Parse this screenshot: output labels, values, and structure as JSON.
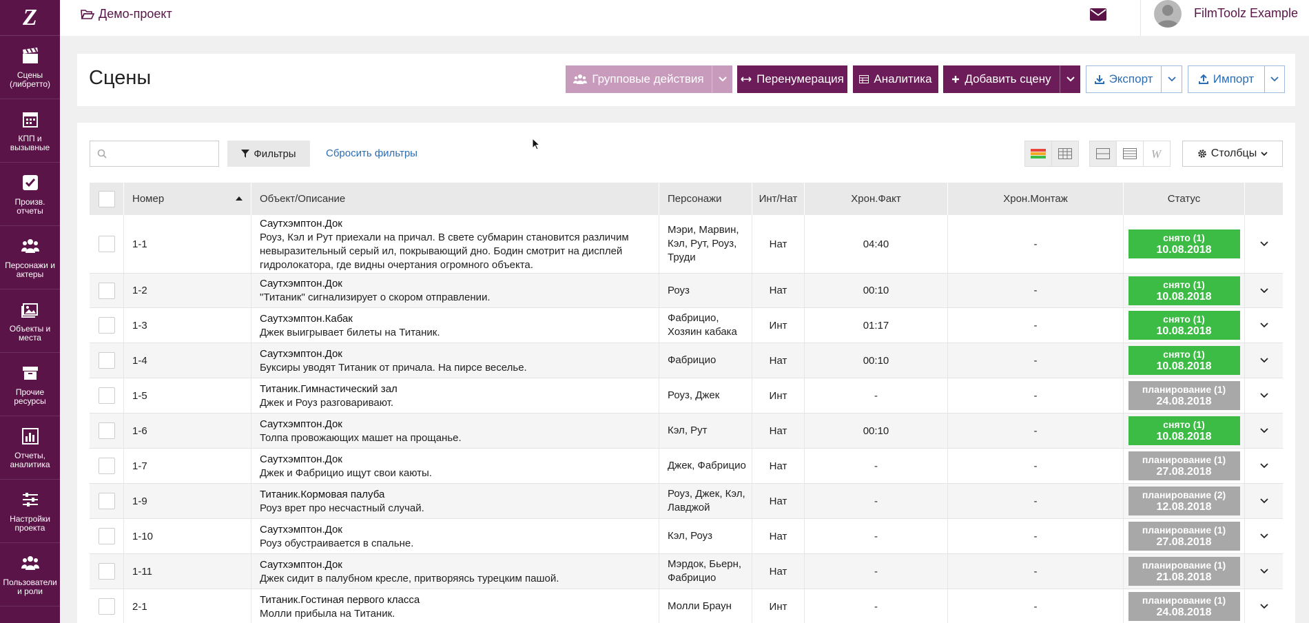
{
  "sidebar": {
    "logo": "Z",
    "items": [
      {
        "label": "Сцены (либретто)",
        "icon": "clapperboard-icon"
      },
      {
        "label": "КПП и вызывные",
        "icon": "calendar-icon"
      },
      {
        "label": "Произв. отчеты",
        "icon": "checkbox-icon"
      },
      {
        "label": "Персонажи и актеры",
        "icon": "users-icon"
      },
      {
        "label": "Объекты и места",
        "icon": "image-icon"
      },
      {
        "label": "Прочие ресурсы",
        "icon": "archive-icon"
      },
      {
        "label": "Отчеты, аналитика",
        "icon": "bar-chart-icon"
      },
      {
        "label": "Настройки проекта",
        "icon": "sliders-icon"
      },
      {
        "label": "Пользователи и роли",
        "icon": "users-icon"
      }
    ]
  },
  "topbar": {
    "project": "Демо-проект",
    "username": "FilmToolz Example"
  },
  "header": {
    "title": "Сцены",
    "bulk_actions": "Групповые действия",
    "renumber": "Перенумерация",
    "analytics": "Аналитика",
    "add_scene": "Добавить сцену",
    "export": "Экспорт",
    "import": "Импорт"
  },
  "toolbar": {
    "search_placeholder": "",
    "filters": "Фильтры",
    "reset_filters": "Сбросить фильтры",
    "columns": "Столбцы"
  },
  "table": {
    "headers": {
      "number": "Номер",
      "object": "Объект/Описание",
      "characters": "Персонажи",
      "int_nat": "Инт/Нат",
      "chron_fact": "Хрон.Факт",
      "chron_edit": "Хрон.Монтаж",
      "status": "Статус"
    },
    "rows": [
      {
        "num": "1-1",
        "object": "Саутхэмптон.Док",
        "desc": "Роуз, Кэл и Рут приехали на причал. В свете субмарин становится различим невыразительный серый ил, покрывающий дно. Бодин смотрит на дисплей гидролокатора, где видны очертания огромного объекта.",
        "chars": "Мэри, Марвин, Кэл, Рут, Роуз, Труди",
        "intnat": "Нат",
        "fact": "04:40",
        "edit": "-",
        "status": "снято (1)",
        "date": "10.08.2018",
        "color": "#3cbc45"
      },
      {
        "num": "1-2",
        "object": "Саутхэмптон.Док",
        "desc": "\"Титаник\" сигнализирует о скором отправлении.",
        "chars": "Роуз",
        "intnat": "Нат",
        "fact": "00:10",
        "edit": "-",
        "status": "снято (1)",
        "date": "10.08.2018",
        "color": "#3cbc45"
      },
      {
        "num": "1-3",
        "object": "Саутхэмптон.Кабак",
        "desc": "Джек выигрывает билеты на Титаник.",
        "chars": "Фабрицио, Хозяин кабака",
        "intnat": "Инт",
        "fact": "01:17",
        "edit": "-",
        "status": "снято (1)",
        "date": "10.08.2018",
        "color": "#3cbc45"
      },
      {
        "num": "1-4",
        "object": "Саутхэмптон.Док",
        "desc": "Буксиры уводят Титаник от причала. На пирсе веселье.",
        "chars": "Фабрицио",
        "intnat": "Нат",
        "fact": "00:10",
        "edit": "-",
        "status": "снято (1)",
        "date": "10.08.2018",
        "color": "#3cbc45"
      },
      {
        "num": "1-5",
        "object": "Титаник.Гимнастический зал",
        "desc": "Джек и Роуз разговаривают.",
        "chars": "Роуз, Джек",
        "intnat": "Инт",
        "fact": "-",
        "edit": "-",
        "status": "планирование (1)",
        "date": "24.08.2018",
        "color": "#a8a8a8"
      },
      {
        "num": "1-6",
        "object": "Саутхэмптон.Док",
        "desc": "Толпа провожающих машет на прощанье.",
        "chars": "Кэл, Рут",
        "intnat": "Нат",
        "fact": "00:10",
        "edit": "-",
        "status": "снято (1)",
        "date": "10.08.2018",
        "color": "#3cbc45"
      },
      {
        "num": "1-7",
        "object": "Саутхэмптон.Док",
        "desc": "Джек и Фабрицио ищут свои каюты.",
        "chars": "Джек, Фабрицио",
        "intnat": "Нат",
        "fact": "-",
        "edit": "-",
        "status": "планирование (1)",
        "date": "27.08.2018",
        "color": "#a8a8a8"
      },
      {
        "num": "1-9",
        "object": "Титаник.Кормовая палуба",
        "desc": "Роуз врет про несчастный случай.",
        "chars": "Роуз, Джек, Кэл, Лавджой",
        "intnat": "Нат",
        "fact": "-",
        "edit": "-",
        "status": "планирование (2)",
        "date": "12.08.2018",
        "color": "#a8a8a8"
      },
      {
        "num": "1-10",
        "object": "Саутхэмптон.Док",
        "desc": "Роуз обустраивается в спальне.",
        "chars": "Кэл, Роуз",
        "intnat": "Нат",
        "fact": "-",
        "edit": "-",
        "status": "планирование (1)",
        "date": "27.08.2018",
        "color": "#a8a8a8"
      },
      {
        "num": "1-11",
        "object": "Саутхэмптон.Док",
        "desc": "Джек сидит в палубном кресле, притворяясь турецким пашой.",
        "chars": "Мэрдок, Бьерн, Фабрицио",
        "intnat": "Нат",
        "fact": "-",
        "edit": "-",
        "status": "планирование (1)",
        "date": "21.08.2018",
        "color": "#a8a8a8"
      },
      {
        "num": "2-1",
        "object": "Титаник.Гостиная первого класса",
        "desc": "Молли прибыла на Титаник.",
        "chars": "Молли Браун",
        "intnat": "Инт",
        "fact": "-",
        "edit": "-",
        "status": "планирование (1)",
        "date": "24.08.2018",
        "color": "#a8a8a8"
      }
    ]
  },
  "colors": {
    "brand": "#5b1448",
    "accent": "#6c1c58",
    "link": "#2a6db5",
    "done": "#3cbc45",
    "planned": "#a8a8a8"
  }
}
